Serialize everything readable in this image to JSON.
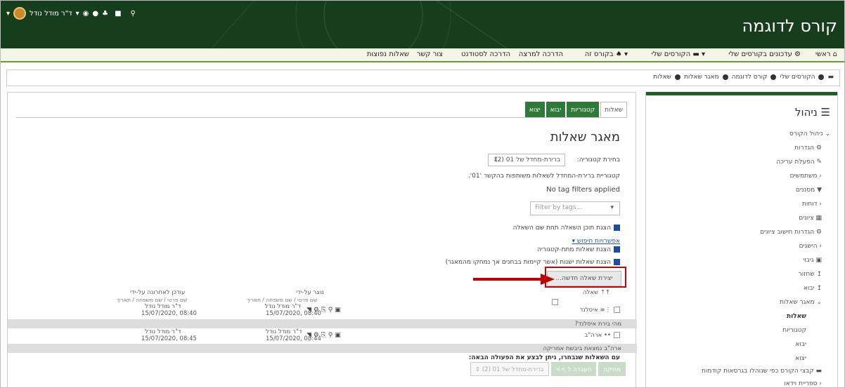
{
  "header": {
    "site_title": "קורס לדוגמה",
    "user_name": "ד\"ר מודל נודל"
  },
  "navbar": {
    "items": [
      "ראשי",
      "עדכונים בקורסים שלי",
      "הקורסים שלי",
      "בקורס זה",
      "הדרכה למרצה",
      "הדרכה לסטודנט",
      "צור קשר",
      "שאלות נפוצות"
    ]
  },
  "breadcrumb": [
    "הקורסים שלי",
    "קורס לדוגמה",
    "מאגר שאלות",
    "שאלות"
  ],
  "admin": {
    "title": "ניהול",
    "items": [
      "ניהול הקורס",
      "הגדרות",
      "הפעלת עריכה",
      "משתמשים",
      "מסננים",
      "דוחות",
      "ציונים",
      "הגדרות חישוב ציונים",
      "הישגים",
      "גיבוי",
      "שחזור",
      "יבוא",
      "מאגר שאלות",
      "שאלות",
      "קטגוריות",
      "יבוא",
      "יצוא",
      "קבצי הקורס כפי שנוהלו בגרסאות קודמות",
      "ספריית וידאו"
    ]
  },
  "tabs": [
    "שאלות",
    "קטגוריות",
    "יבוא",
    "יצוא"
  ],
  "page": {
    "title": "מאגר שאלות",
    "category_label": "בחירת קטגוריה:",
    "category_value": "ברירת-מחדל של 01 (2)",
    "category_desc": "קטגוריית ברירת-המחדל לשאלות משותפות בהקשר '01'.",
    "no_tag": "No tag filters applied",
    "filter_placeholder": "Filter by tags...",
    "show_text": "הצגת תוכן השאלה תחת שם השאלה",
    "search_options": "אפשרויות חיפוש",
    "show_sub": "הצגת שאלות מתת-קטגוריה",
    "show_old": "הצגת שאלות ישנות (אשר קיימות בבחנים אך נמחקו מהמאגר)",
    "create_button": "יצירת שאלה חדשה...",
    "after_select": "עם השאלות שנבחרו, ניתן לבצע את הפעולה הבאה:"
  },
  "table": {
    "col_question": "שאלה",
    "col_created": "נוצר על-ידי",
    "col_created_sub": "שם פרטי / שם משפחה / תאריך",
    "col_updated": "עודכן לאחרונה על-ידי",
    "col_updated_sub": "שם פרטי / שם משפחה / תאריך",
    "rows": [
      {
        "name": "איסלנד",
        "text": "מהי בירת איסלנד?",
        "creator": "ד\"ר מודל נודל",
        "created": "08:40 ,15/07/2020",
        "updater": "ד\"ר מודל נודל",
        "updated": "08:40 ,15/07/2020"
      },
      {
        "name": "ארה\"ב",
        "text": "ארה\"ב נמצאת ביבשת אמריקה",
        "creator": "ד\"ר מודל נודל",
        "created": "08:44 ,15/07/2020",
        "updater": "ד\"ר מודל נודל",
        "updated": "08:45 ,15/07/2020"
      }
    ]
  },
  "actions": {
    "delete": "מחיקה",
    "move_to": "העברה ל >>",
    "target": "ברירת-מחדל של 01 (2)"
  },
  "colors": {
    "topbar": "#173e1c",
    "accent": "#2f7a3a",
    "arrow": "#c00000"
  }
}
